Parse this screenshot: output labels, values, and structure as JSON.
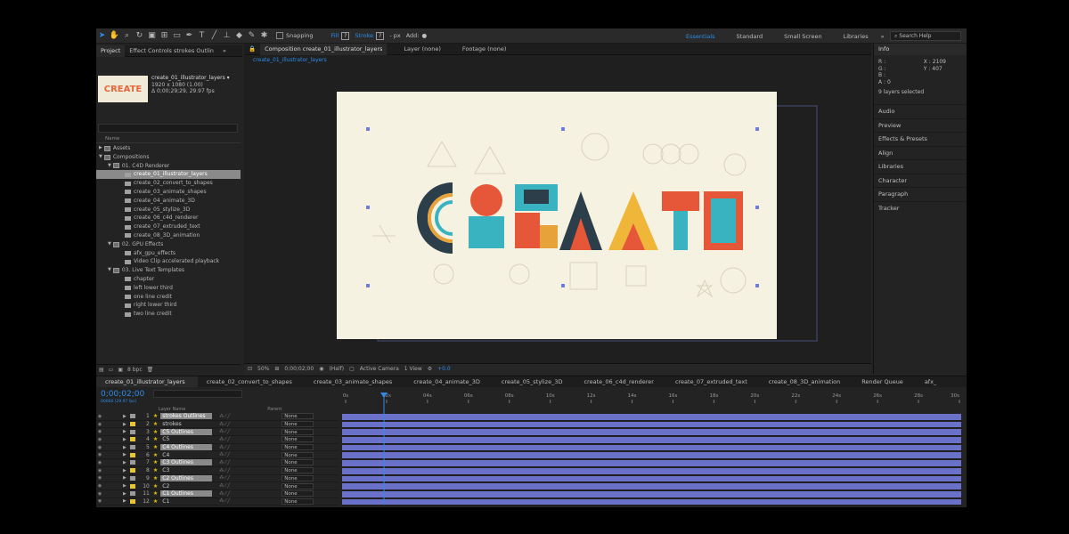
{
  "toolbar": {
    "snapping": "Snapping",
    "fill": "Fill",
    "fill_q": "?",
    "stroke": "Stroke",
    "stroke_q": "?",
    "px": "- px",
    "add": "Add:"
  },
  "workspaces": [
    "Essentials",
    "Standard",
    "Small Screen",
    "Libraries"
  ],
  "search_help": "Search Help",
  "project": {
    "tabs": [
      "Project",
      "Effect Controls strokes Outlin"
    ],
    "comp_name": "create_01_illustrator_layers ▾",
    "comp_size": "1920 x 1080 (1.00)",
    "comp_duration": "Δ 0;00;29;29, 29.97 fps",
    "name_header": "Name",
    "tree": [
      {
        "label": "Assets",
        "indent": 0,
        "type": "folder",
        "twirl": "▶"
      },
      {
        "label": "Compositions",
        "indent": 0,
        "type": "folder",
        "twirl": "▼"
      },
      {
        "label": "01. C4D Renderer",
        "indent": 1,
        "type": "folder",
        "twirl": "▼"
      },
      {
        "label": "create_01_illustrator_layers",
        "indent": 2,
        "type": "comp",
        "selected": true
      },
      {
        "label": "create_02_convert_to_shapes",
        "indent": 2,
        "type": "comp"
      },
      {
        "label": "create_03_animate_shapes",
        "indent": 2,
        "type": "comp"
      },
      {
        "label": "create_04_animate_3D",
        "indent": 2,
        "type": "comp"
      },
      {
        "label": "create_05_stylize_3D",
        "indent": 2,
        "type": "comp"
      },
      {
        "label": "create_06_c4d_renderer",
        "indent": 2,
        "type": "comp"
      },
      {
        "label": "create_07_extruded_text",
        "indent": 2,
        "type": "comp"
      },
      {
        "label": "create_08_3D_animation",
        "indent": 2,
        "type": "comp"
      },
      {
        "label": "02. GPU Effects",
        "indent": 1,
        "type": "folder",
        "twirl": "▼"
      },
      {
        "label": "afx_gpu_effects",
        "indent": 2,
        "type": "comp"
      },
      {
        "label": "Video Clip accelerated playback",
        "indent": 2,
        "type": "comp"
      },
      {
        "label": "03. Live Text Templates",
        "indent": 1,
        "type": "folder",
        "twirl": "▼"
      },
      {
        "label": "chapter",
        "indent": 2,
        "type": "comp"
      },
      {
        "label": "left lower third",
        "indent": 2,
        "type": "comp"
      },
      {
        "label": "one line credit",
        "indent": 2,
        "type": "comp"
      },
      {
        "label": "right lower third",
        "indent": 2,
        "type": "comp"
      },
      {
        "label": "two line credit",
        "indent": 2,
        "type": "comp"
      }
    ],
    "bpc": "8 bpc"
  },
  "composition": {
    "tabs": [
      "Composition create_01_illustrator_layers",
      "Layer (none)",
      "Footage (none)"
    ],
    "subtab": "create_01_illustrator_layers",
    "canvas_text": "CREATE",
    "viewer": {
      "zoom": "50%",
      "timecode": "0;00;02;00",
      "resolution": "(Half)",
      "camera": "Active Camera",
      "views": "1 View",
      "exposure": "+0.0"
    }
  },
  "info": {
    "title": "Info",
    "r": "R :",
    "g": "G :",
    "b": "B :",
    "a": "A : 0",
    "x": "X : 2109",
    "y": "Y : 407",
    "layers_selected": "9 layers selected",
    "panels": [
      "Audio",
      "Preview",
      "Effects & Presets",
      "Align",
      "Libraries",
      "Character",
      "Paragraph",
      "Tracker"
    ]
  },
  "timeline": {
    "tabs": [
      "create_01_illustrator_layers",
      "create_02_convert_to_shapes",
      "create_03_animate_shapes",
      "create_04_animate_3D",
      "create_05_stylize_3D",
      "create_06_c4d_renderer",
      "create_07_extruded_text",
      "create_08_3D_animation",
      "Render Queue",
      "afx_"
    ],
    "timecode": "0;00;02;00",
    "timecode_sub": "00060 (29.97 fps)",
    "col_layer_name": "Layer Name",
    "col_parent": "Parent",
    "ruler": [
      "0s",
      "02s",
      "04s",
      "06s",
      "08s",
      "10s",
      "12s",
      "14s",
      "16s",
      "18s",
      "20s",
      "22s",
      "24s",
      "26s",
      "28s",
      "30s"
    ],
    "layers": [
      {
        "num": "1",
        "name": "strokes Outlines",
        "hl": true,
        "color": "#9b9b9b",
        "parent": "None"
      },
      {
        "num": "2",
        "name": "strokes",
        "hl": false,
        "color": "#e6c43c",
        "parent": "None"
      },
      {
        "num": "3",
        "name": "C5 Outlines",
        "hl": true,
        "color": "#9b9b9b",
        "parent": "None"
      },
      {
        "num": "4",
        "name": "C5",
        "hl": false,
        "color": "#e6c43c",
        "parent": "None"
      },
      {
        "num": "5",
        "name": "C4 Outlines",
        "hl": true,
        "color": "#9b9b9b",
        "parent": "None"
      },
      {
        "num": "6",
        "name": "C4",
        "hl": false,
        "color": "#e6c43c",
        "parent": "None"
      },
      {
        "num": "7",
        "name": "C3 Outlines",
        "hl": true,
        "color": "#9b9b9b",
        "parent": "None"
      },
      {
        "num": "8",
        "name": "C3",
        "hl": false,
        "color": "#e6c43c",
        "parent": "None"
      },
      {
        "num": "9",
        "name": "C2 Outlines",
        "hl": true,
        "color": "#9b9b9b",
        "parent": "None"
      },
      {
        "num": "10",
        "name": "C2",
        "hl": false,
        "color": "#e6c43c",
        "parent": "None"
      },
      {
        "num": "11",
        "name": "C1 Outlines",
        "hl": true,
        "color": "#9b9b9b",
        "parent": "None"
      },
      {
        "num": "12",
        "name": "C1",
        "hl": false,
        "color": "#e6c43c",
        "parent": "None"
      }
    ]
  }
}
